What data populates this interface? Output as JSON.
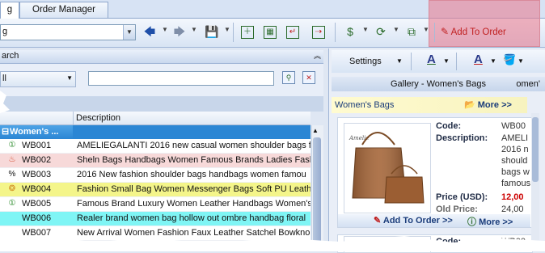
{
  "tabs": [
    {
      "label": "g"
    },
    {
      "label": "Order Manager"
    }
  ],
  "toolbar": {
    "combo_value": "g",
    "add_to_order_label": "Add To Order"
  },
  "search": {
    "header": "arch",
    "combo_value": "ll",
    "input_value": ""
  },
  "grid": {
    "columns": [
      "Description"
    ],
    "group_label": "Women's ...",
    "rows": [
      {
        "code": "WB001",
        "desc": "AMELIEGALANTI 2016 new casual women shoulder bags f",
        "bg": "#ffffff",
        "icon": "badge-icon"
      },
      {
        "code": "WB002",
        "desc": "Sheln Bags Handbags Women Famous Brands Ladies Fash",
        "bg": "#f7d9d9",
        "icon": "flame-icon"
      },
      {
        "code": "WB003",
        "desc": "2016 New fashion shoulder bags handbags women famou",
        "bg": "#ffffff",
        "icon": "percent-icon"
      },
      {
        "code": "WB004",
        "desc": "Fashion Small Bag Women Messenger Bags Soft PU Leathe",
        "bg": "#f4f58a",
        "icon": "ribbon-icon"
      },
      {
        "code": "WB005",
        "desc": "Famous Brand Luxury Women Leather Handbags Women's",
        "bg": "#ffffff",
        "icon": "badge-icon"
      },
      {
        "code": "WB006",
        "desc": "Realer brand women bag hollow out ombre handbag floral",
        "bg": "#7ff5f5",
        "icon": ""
      },
      {
        "code": "WB007",
        "desc": "New Arrival Women Fashion Faux Leather Satchel Bowkno",
        "bg": "#ffffff",
        "icon": ""
      }
    ]
  },
  "right": {
    "settings_label": "Settings",
    "gallery_title": "Gallery - Women's Bags",
    "gallery_title_cut": "omen'",
    "category": "Women's Bags",
    "more_label": "More >>",
    "card": {
      "code_label": "Code:",
      "code_value": "WB00",
      "desc_label": "Description:",
      "desc_lines": [
        "AMELI",
        "2016 n",
        "should",
        "bags w",
        "famous"
      ],
      "price_label": "Price (USD):",
      "price_value": "12,00",
      "old_price_label": "Old Price:",
      "old_price_value": "24,00",
      "add_to_order": "Add To Order >>",
      "more": "More >>",
      "photo_caption": "Amelie"
    },
    "card2": {
      "code_label": "Code:",
      "code_value": "WB00"
    }
  },
  "colors": {
    "accent": "#1a3c7a",
    "price": "#cc0000",
    "highlight": "#e77e92"
  }
}
